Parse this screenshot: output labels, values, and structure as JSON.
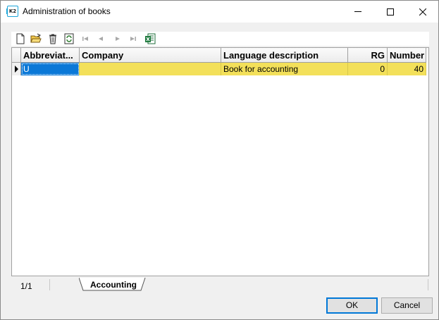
{
  "window": {
    "title": "Administration of books",
    "icon_text": "K2"
  },
  "toolbar": {
    "buttons": [
      {
        "name": "new-icon",
        "enabled": true
      },
      {
        "name": "open-folder-icon",
        "enabled": true
      },
      {
        "name": "delete-icon",
        "enabled": true
      },
      {
        "name": "refresh-icon",
        "enabled": true
      },
      {
        "name": "first-record-icon",
        "enabled": false
      },
      {
        "name": "previous-record-icon",
        "enabled": false
      },
      {
        "name": "next-record-icon",
        "enabled": false
      },
      {
        "name": "last-record-icon",
        "enabled": false
      },
      {
        "name": "excel-export-icon",
        "enabled": true
      }
    ]
  },
  "grid": {
    "columns": [
      {
        "key": "abbreviation",
        "label": "Abbreviat..."
      },
      {
        "key": "company",
        "label": "Company"
      },
      {
        "key": "language_description",
        "label": "Language description"
      },
      {
        "key": "rg",
        "label": "RG"
      },
      {
        "key": "number",
        "label": "Number"
      }
    ],
    "rows": [
      {
        "abbreviation": "U",
        "company": "",
        "language_description": "Book for accounting",
        "rg": "0",
        "number": "40"
      }
    ],
    "colors": {
      "row_highlight": "#f3e05a",
      "selected_cell": "#0a78d7"
    }
  },
  "status": {
    "page_count": "1/1",
    "tab_label": "Accounting"
  },
  "buttons": {
    "ok_label": "OK",
    "cancel_label": "Cancel"
  }
}
